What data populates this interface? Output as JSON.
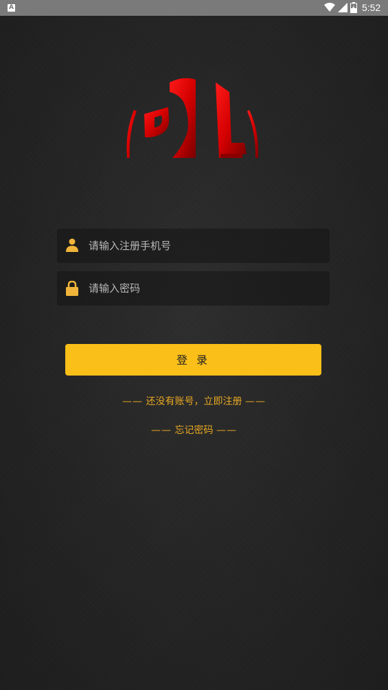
{
  "status_bar": {
    "notification_icon": "A",
    "time": "5:52",
    "icons": [
      "wifi-icon",
      "signal-icon",
      "battery-icon"
    ]
  },
  "logo": {
    "icon": "brand-logo"
  },
  "form": {
    "phone_placeholder": "请输入注册手机号",
    "phone_value": "",
    "password_placeholder": "请输入密码",
    "password_value": "",
    "phone_icon": "user-icon",
    "password_icon": "lock-icon"
  },
  "login_button": {
    "label": "登 录"
  },
  "links": {
    "dash": "——",
    "register": "还没有账号，立即注册",
    "forgot": "忘记密码"
  },
  "colors": {
    "accent": "#fbbf19",
    "link": "#e7a823",
    "logo_red": "#d40000",
    "background": "#262626"
  }
}
